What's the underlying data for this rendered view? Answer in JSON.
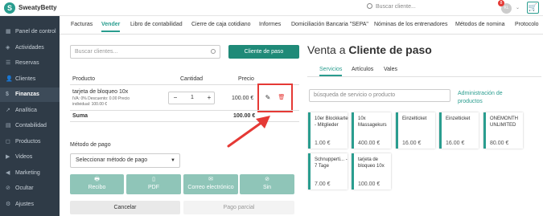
{
  "topbar": {
    "logo_letter": "S",
    "brand": "SweatyBetty",
    "search_placeholder": "Buscar cliente...",
    "notif_count": "8",
    "avatar_initials": "KL"
  },
  "sidebar": {
    "items": [
      {
        "icon": "▦",
        "label": "Panel de control"
      },
      {
        "icon": "◈",
        "label": "Actividades"
      },
      {
        "icon": "☰",
        "label": "Reservas"
      },
      {
        "icon": "👤",
        "label": "Clientes"
      },
      {
        "icon": "$",
        "label": "Finanzas"
      },
      {
        "icon": "↗",
        "label": "Analítica"
      },
      {
        "icon": "▤",
        "label": "Contabilidad"
      },
      {
        "icon": "◻",
        "label": "Productos"
      },
      {
        "icon": "▶",
        "label": "Videos"
      },
      {
        "icon": "◀",
        "label": "Marketing"
      },
      {
        "icon": "⊘",
        "label": "Ocultar"
      },
      {
        "icon": "⚙",
        "label": "Ajustes"
      }
    ]
  },
  "tabs": [
    "Facturas",
    "Vender",
    "Libro de contabilidad",
    "Cierre de caja cotidiano",
    "Informes",
    "Domiciliación Bancaria \"SEPA\"",
    "Nóminas de los entrenadores",
    "Métodos de nomina",
    "Protocolo"
  ],
  "left": {
    "customer_search_placeholder": "Buscar clientes...",
    "walkin_button": "Cliente de paso",
    "col_product": "Producto",
    "col_quantity": "Cantidad",
    "col_price": "Precio",
    "item_name": "tarjeta de bloqueo 10x",
    "item_detail_1": "IVA: 0% Descuento: 0.00 Precio",
    "item_detail_2": "individual: 100.00 €",
    "qty_minus": "−",
    "qty_value": "1",
    "qty_plus": "+",
    "item_price": "100.00 €",
    "sum_label": "Suma",
    "sum_value": "100.00 €",
    "payment_label": "Método de pago",
    "payment_select": "Seleccionar método de pago",
    "pay_buttons": [
      {
        "icon": "🖶",
        "label": "Recibo"
      },
      {
        "icon": "▯",
        "label": "PDF"
      },
      {
        "icon": "✉",
        "label": "Correo electrónico"
      },
      {
        "icon": "⊘",
        "label": "Sin"
      }
    ],
    "cancel_button": "Cancelar",
    "partial_button": "Pago parcial"
  },
  "right": {
    "title_prefix": "Venta a ",
    "title_bold": "Cliente de paso",
    "subtabs": [
      "Servicios",
      "Artículos",
      "Vales"
    ],
    "service_search_placeholder": "búsqueda de servicio o producto",
    "admin_link": "Administración de productos",
    "cards": [
      {
        "name": "10er Blockkarte - Mitglieder",
        "price": "1.00 €"
      },
      {
        "name": "10x Massagekurs",
        "price": "400.00 €"
      },
      {
        "name": "Einzelticket",
        "price": "16.00 €"
      },
      {
        "name": "Einzelticket",
        "price": "16.00 €"
      },
      {
        "name": "ONEMONTH UNLIMITED",
        "price": "80.00 €"
      },
      {
        "name": "Schnupperti... - 7 Tage",
        "price": "7.00 €"
      },
      {
        "name": "tarjeta de bloqueo 10x",
        "price": "100.00 €"
      }
    ]
  },
  "colors": {
    "accent": "#2a9d8f",
    "sidebar": "#2f3b47",
    "highlight": "#e53935"
  }
}
